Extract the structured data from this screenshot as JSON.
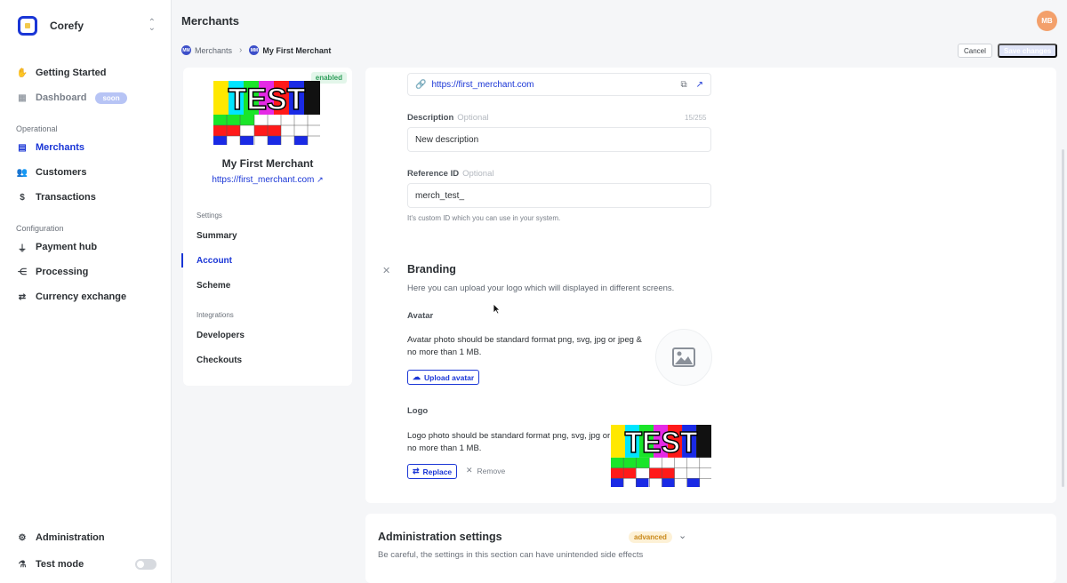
{
  "sidebar": {
    "brand": "Corefy",
    "items": {
      "getting_started": "Getting Started",
      "dashboard": "Dashboard",
      "dashboard_badge": "soon",
      "merchants": "Merchants",
      "customers": "Customers",
      "transactions": "Transactions",
      "payment_hub": "Payment hub",
      "processing": "Processing",
      "currency_exchange": "Currency exchange",
      "administration": "Administration",
      "test_mode": "Test mode"
    },
    "groups": {
      "operational": "Operational",
      "configuration": "Configuration"
    },
    "test_mode_on": false
  },
  "header": {
    "title": "Merchants",
    "user_initials": "MB",
    "breadcrumb": {
      "root_badge": "MM",
      "root": "Merchants",
      "current_badge": "MM",
      "current": "My First Merchant"
    },
    "cancel_label": "Cancel",
    "save_label": "Save changes"
  },
  "merchant_card": {
    "status": "enabled",
    "logo_text": "TEST",
    "name": "My First Merchant",
    "url": "https://first_merchant.com",
    "settings_group": "Settings",
    "settings_items": [
      "Summary",
      "Account",
      "Scheme"
    ],
    "integrations_group": "Integrations",
    "integration_items": [
      "Developers",
      "Checkouts"
    ]
  },
  "form": {
    "website_value": "https://first_merchant.com",
    "description_label": "Description",
    "description_optional": "Optional",
    "description_counter": "15/255",
    "description_value": "New description",
    "reference_label": "Reference ID",
    "reference_optional": "Optional",
    "reference_value": "merch_test_",
    "reference_hint": "It's custom ID which you can use in your system."
  },
  "branding": {
    "title": "Branding",
    "description": "Here you can upload your logo which will displayed in different screens.",
    "avatar_label": "Avatar",
    "avatar_text": "Avatar photo should be standard format png, svg, jpg or jpeg & no more than 1 MB.",
    "upload_avatar_label": "Upload avatar",
    "logo_label": "Logo",
    "logo_text": "Logo photo should be standard format png, svg, jpg or jpeg & no more than 1 MB.",
    "replace_label": "Replace",
    "remove_label": "Remove",
    "logo_preview_text": "TEST"
  },
  "admin": {
    "title": "Administration settings",
    "badge": "advanced",
    "description": "Be careful, the settings in this section can have unintended side effects"
  },
  "colors": {
    "accent": "#1a36d6",
    "enabled": "#2f9e5b",
    "advanced": "#c9891b"
  }
}
